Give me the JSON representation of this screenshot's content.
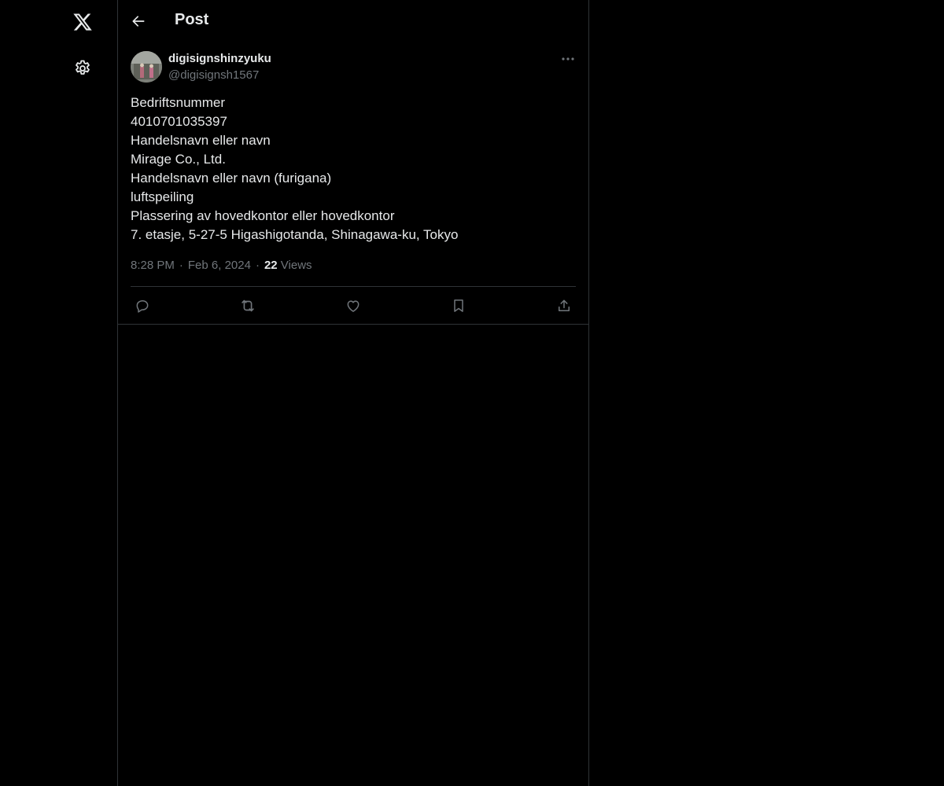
{
  "nav": {
    "logo_icon": "x-logo-icon",
    "settings_icon": "gear-icon"
  },
  "header": {
    "back_icon": "arrow-left-icon",
    "title": "Post"
  },
  "post": {
    "author": {
      "name": "digisignshinzyuku",
      "handle": "@digisignsh1567"
    },
    "more_icon": "more-horizontal-icon",
    "lines": [
      "Bedriftsnummer",
      "4010701035397",
      "Handelsnavn eller navn",
      "Mirage Co., Ltd.",
      "Handelsnavn eller navn (furigana)",
      "luftspeiling",
      "Plassering av hovedkontor eller hovedkontor",
      "7. etasje, 5-27-5 Higashigotanda, Shinagawa-ku, Tokyo"
    ],
    "time": "8:28 PM",
    "date": "Feb 6, 2024",
    "separator": "·",
    "views_count": "22",
    "views_label": "Views",
    "actions": [
      "reply-icon",
      "repost-icon",
      "like-icon",
      "bookmark-icon",
      "share-icon"
    ]
  },
  "colors": {
    "background": "#000000",
    "text_primary": "#e7e9ea",
    "text_secondary": "#71767b",
    "border": "#2f3336"
  }
}
